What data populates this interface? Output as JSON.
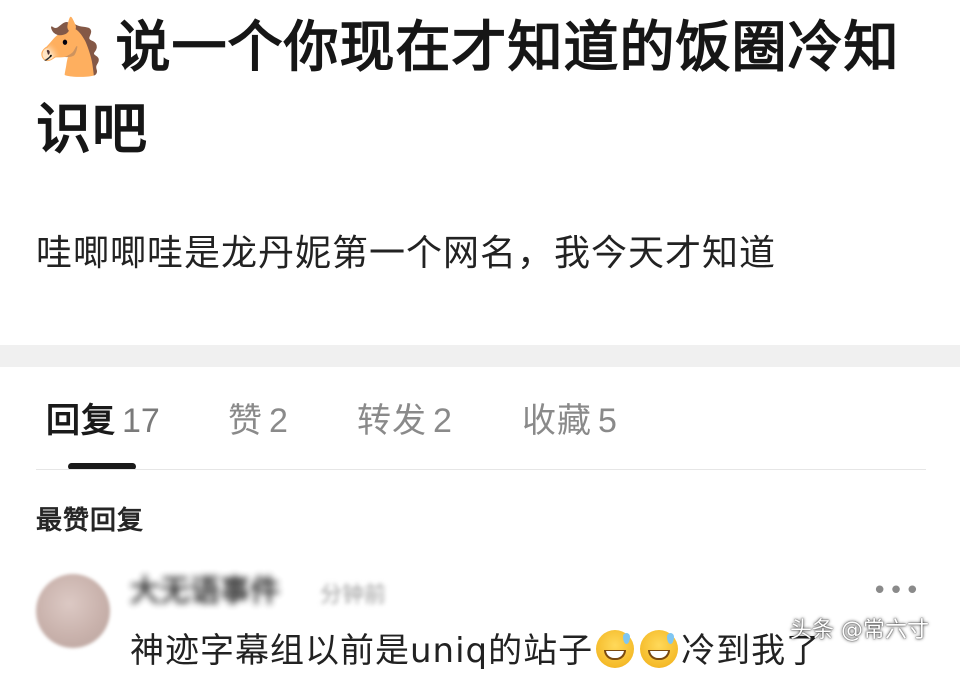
{
  "post": {
    "title_emoji": "🐴",
    "title": "说一个你现在才知道的饭圈冷知识吧",
    "body": "哇唧唧哇是龙丹妮第一个网名，我今天才知道"
  },
  "tabs": [
    {
      "label": "回复",
      "count": "17",
      "active": true
    },
    {
      "label": "赞",
      "count": "2",
      "active": false
    },
    {
      "label": "转发",
      "count": "2",
      "active": false
    },
    {
      "label": "收藏",
      "count": "5",
      "active": false
    }
  ],
  "section": {
    "heading": "最赞回复"
  },
  "reply": {
    "author": "大无语事件",
    "time": "分钟前",
    "text_before": "神迹字幕组以前是uniq的站子",
    "emoji": "sweat-smile-emoji",
    "text_after": "冷到我了",
    "more_label": "•••"
  },
  "watermark": "头条 @常六寸",
  "colors": {
    "active_tab": "#1a1a1a",
    "inactive_tab": "#8a8a8a",
    "divider": "#f0f0f0"
  }
}
